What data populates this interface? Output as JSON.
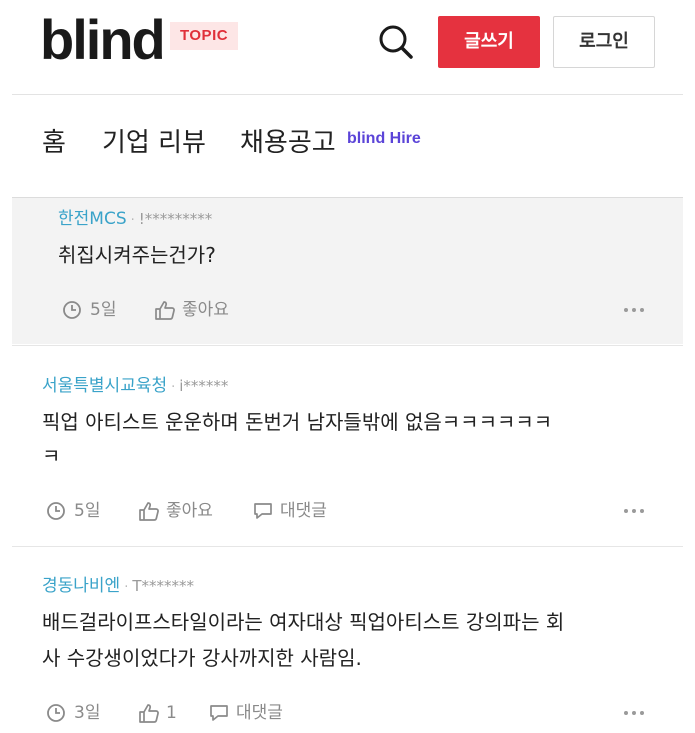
{
  "header": {
    "logo": "blind",
    "topic_badge": "TOPIC",
    "write_label": "글쓰기",
    "login_label": "로그인",
    "search_icon": "search-icon"
  },
  "nav": {
    "items": [
      "홈",
      "기업 리뷰",
      "채용공고"
    ],
    "hire_label": "blind Hire"
  },
  "comments": [
    {
      "company": "한전MCS",
      "user": "!*********",
      "body": "취집시켜주는건가?",
      "time": "5일",
      "likes": "좋아요"
    },
    {
      "company": "서울특별시교육청",
      "user": "i******",
      "body_line1": "픽업 아티스트 운운하며 돈번거 남자들밖에 없음ㅋㅋㅋㅋㅋㅋ",
      "body_line2": "ㅋ",
      "time": "5일",
      "likes": "좋아요",
      "reply": "대댓글"
    },
    {
      "company": "경동나비엔",
      "user": "T*******",
      "body_line1": "배드걸라이프스타일이라는 여자대상 픽업아티스트 강의파는 회",
      "body_line2": "사 수강생이었다가 강사까지한 사람임.",
      "time": "3일",
      "likes": "1",
      "reply": "대댓글"
    }
  ],
  "colors": {
    "accent": "#e5323f",
    "company": "#3aa3c9",
    "hire": "#5b44d8"
  }
}
